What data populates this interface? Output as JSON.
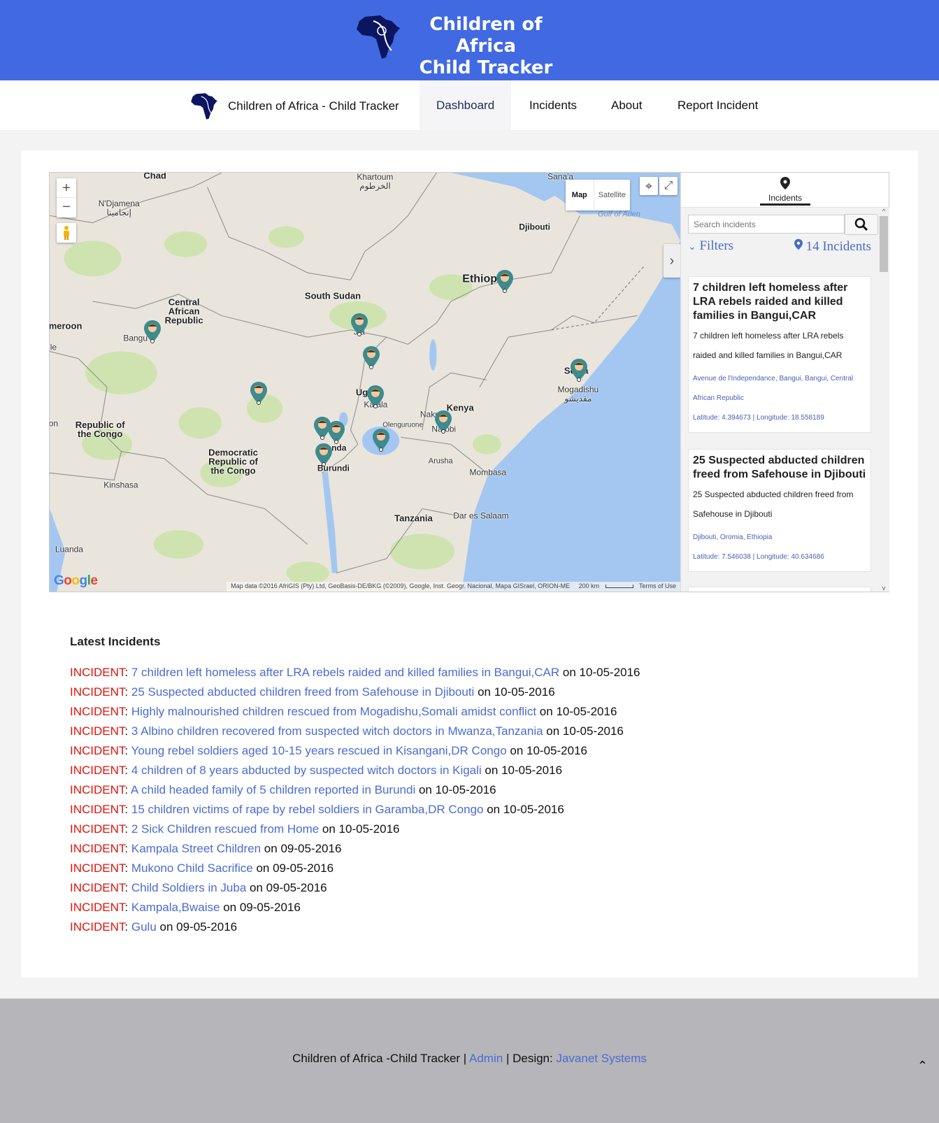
{
  "banner": {
    "title_line1": "Children of Africa",
    "title_line2": "Child Tracker"
  },
  "nav": {
    "brand": "Children of Africa - Child Tracker",
    "items": [
      {
        "label": "Dashboard",
        "active": true
      },
      {
        "label": "Incidents"
      },
      {
        "label": "About"
      },
      {
        "label": "Report Incident"
      }
    ]
  },
  "map": {
    "controls": {
      "zoom_in": "+",
      "zoom_out": "−",
      "map_type_map": "Map",
      "map_type_satellite": "Satellite",
      "selected_type": "Map"
    },
    "labels": {
      "chad": "Chad",
      "khartoum": "Khartoum",
      "khartoum_ar": "الخرطوم",
      "ndjamena": "N'Djamena",
      "ndjamena_ar": "إنجامينا",
      "car": "Central African Republic",
      "south_sudan": "South Sudan",
      "ethiopia": "Ethiop",
      "djibouti": "Djibouti",
      "sanaa": "Sana'a",
      "gulf_aden": "Gulf of Aden",
      "somalia": "So    lia",
      "mogadishu": "Mogadishu",
      "mogadishu_ar": "مقديشو",
      "kenya": "Kenya",
      "uganda": "Ug",
      "kampala": "Ka    ala",
      "nairobi": "Na  obi",
      "nakuru": "Naku",
      "olenguruone": "Olenguruone",
      "rwanda": " anda",
      "burundi": "Burundi",
      "drc": "Democratic Republic of the Congo",
      "roc": "Republic of the Congo",
      "kinshasa": "Kinshasa",
      "tanzania": "Tanzania",
      "dar": "Dar es Salaam",
      "mombasa": "Mombasa",
      "arusha": "Arusha",
      "luanda": "Luanda",
      "cameroon": "meroon",
      "bangui": "Bangu",
      "juba": "J  a",
      "on": "on",
      "le": "le"
    },
    "marker_count_visible": 12,
    "google_logo": "Google",
    "attribution": "Map data ©2016 AfriGIS (Pty) Ltd, GeoBasis-DE/BKG (©2009), Google, Inst. Geogr. Nacional, Mapa GISrael, ORION-ME",
    "scale": "200 km",
    "terms": "Terms of Use",
    "colors": {
      "land": "#e9e5dc",
      "water": "#a3c7f0",
      "park": "#cfe3b0",
      "marker": "#3e8a8d"
    }
  },
  "panel": {
    "tab_label": "Incidents",
    "search_placeholder": "Search incidents",
    "filters_label": "Filters",
    "count_label": "14 Incidents",
    "cards": [
      {
        "title": "7 children left homeless after LRA rebels raided and killed families in Bangui,CAR",
        "description": "7 children left homeless after LRA rebels raided and killed families in Bangui,CAR",
        "address": "Avenue de l'Independance, Bangui, Bangui, Central African Republic",
        "coords": "Latitude: 4.394673 | Longitude: 18.558189"
      },
      {
        "title": "25 Suspected abducted children freed from Safehouse in Djibouti",
        "description": "25 Suspected abducted children freed from Safehouse in Djibouti",
        "address": "Djibouti, Oromia, Ethiopia",
        "coords": "Latitude: 7.546038 | Longitude: 40.634686"
      }
    ]
  },
  "latest": {
    "heading": "Latest Incidents",
    "prefix": "INCIDENT",
    "items": [
      {
        "title": "7 children left homeless after LRA rebels raided and killed families in Bangui,CAR",
        "date": "10-05-2016"
      },
      {
        "title": "25 Suspected abducted children freed from Safehouse in Djibouti",
        "date": "10-05-2016"
      },
      {
        "title": "Highly malnourished children rescued from Mogadishu,Somali amidst conflict",
        "date": "10-05-2016"
      },
      {
        "title": "3 Albino children recovered from suspected witch doctors in Mwanza,Tanzania",
        "date": "10-05-2016"
      },
      {
        "title": "Young rebel soldiers aged 10-15 years rescued in Kisangani,DR Congo",
        "date": "10-05-2016"
      },
      {
        "title": "4 children of 8 years abducted by suspected witch doctors in Kigali",
        "date": "10-05-2016"
      },
      {
        "title": "A child headed family of 5 children reported in Burundi",
        "date": "10-05-2016"
      },
      {
        "title": "15 children victims of rape by rebel soldiers in Garamba,DR Congo",
        "date": "10-05-2016"
      },
      {
        "title": "2 Sick Children rescued from Home",
        "date": "10-05-2016"
      },
      {
        "title": "Kampala Street Children",
        "date": "09-05-2016"
      },
      {
        "title": "Mukono Child Sacrifice",
        "date": "09-05-2016"
      },
      {
        "title": "Child Soldiers in Juba",
        "date": "09-05-2016"
      },
      {
        "title": "Kampala,Bwaise",
        "date": "09-05-2016"
      },
      {
        "title": "Gulu",
        "date": "09-05-2016"
      }
    ]
  },
  "footer": {
    "site": "Children of Africa -Child Tracker",
    "sep": "|",
    "admin": "Admin",
    "design_label": "Design:",
    "designer": "Javanet Systems"
  }
}
